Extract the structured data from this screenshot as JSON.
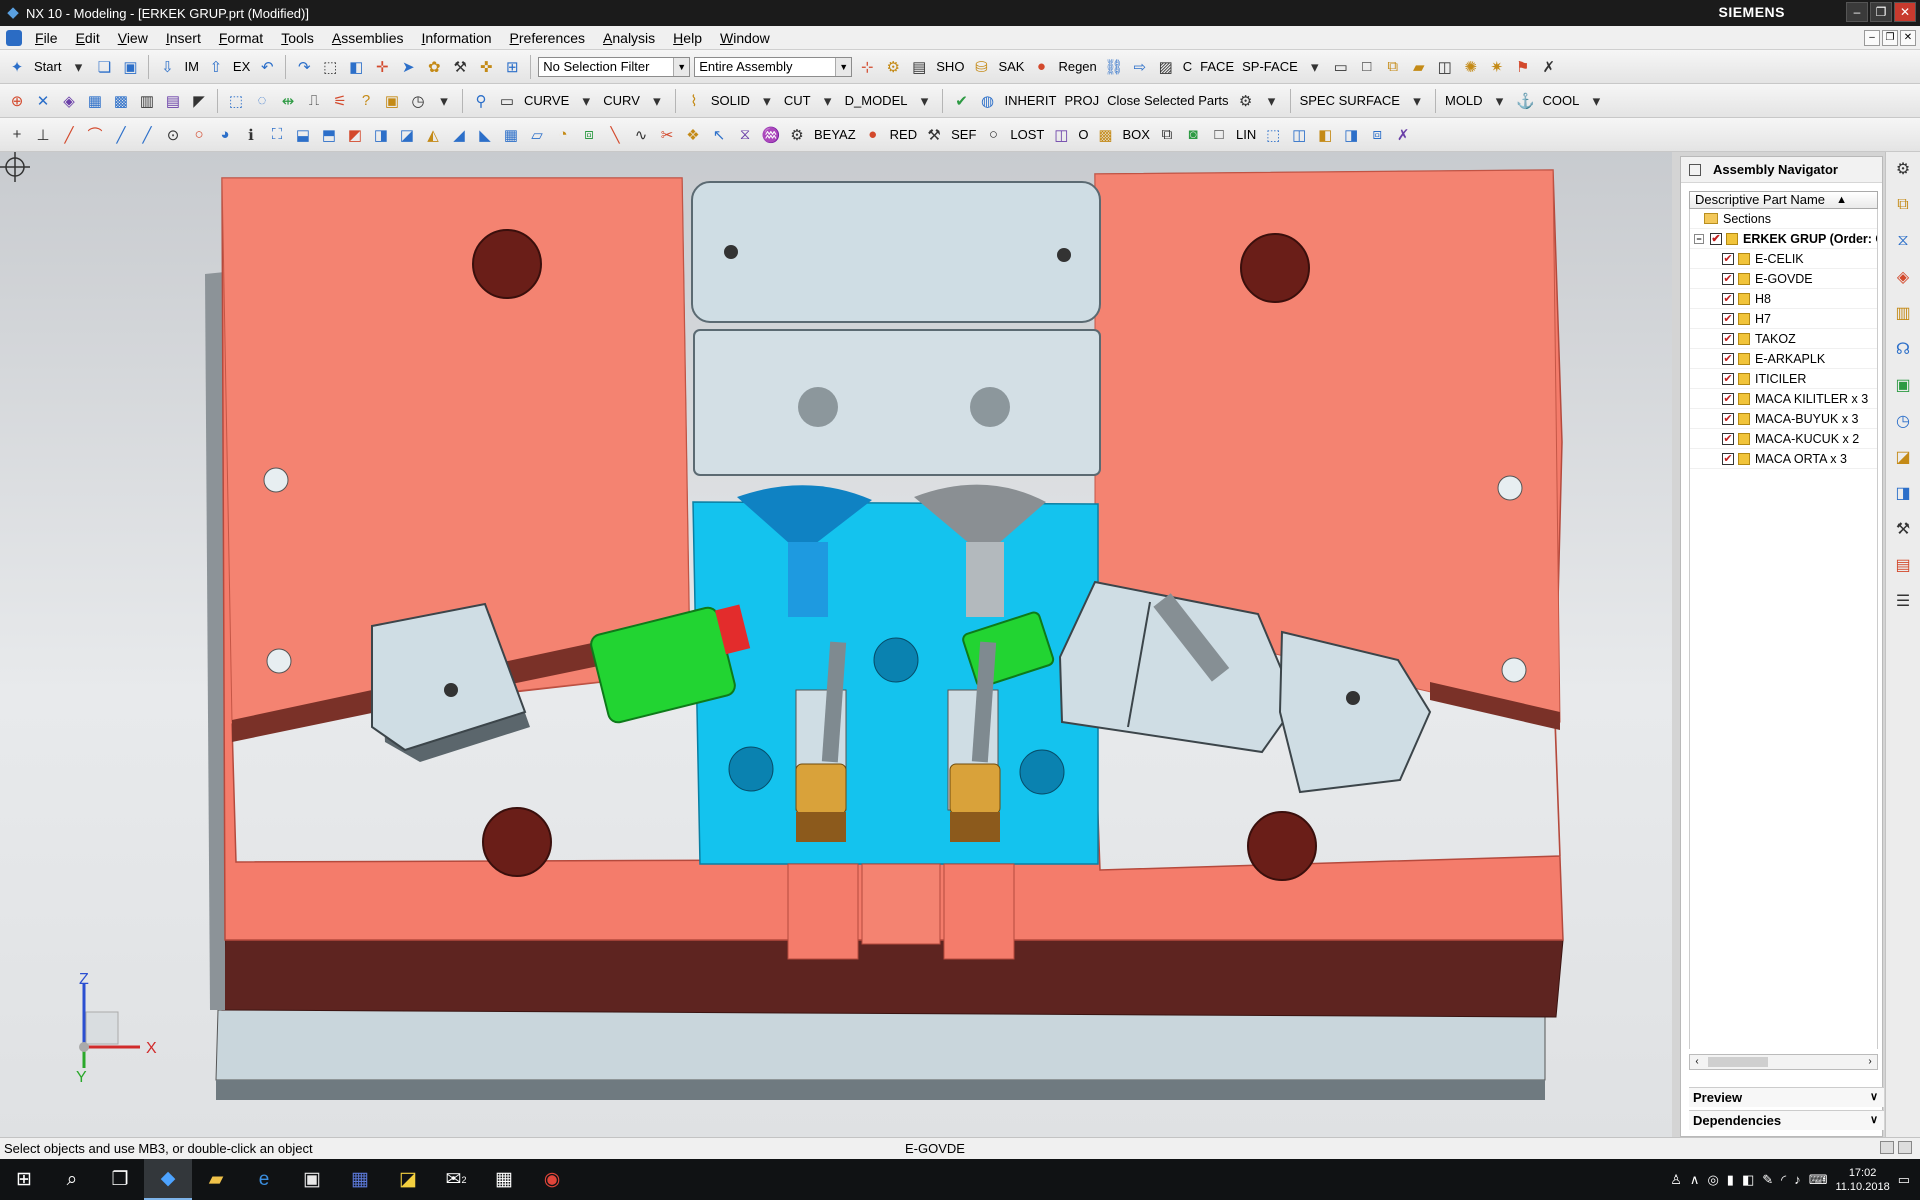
{
  "window": {
    "title": "NX 10 - Modeling - [ERKEK GRUP.prt (Modified)]",
    "brand": "SIEMENS"
  },
  "menu": [
    "File",
    "Edit",
    "View",
    "Insert",
    "Format",
    "Tools",
    "Assemblies",
    "Information",
    "Preferences",
    "Analysis",
    "Help",
    "Window"
  ],
  "toolbar1": {
    "start_label": "Start",
    "im_label": "IM",
    "ex_label": "EX",
    "selection_filter": "No Selection Filter",
    "scope": "Entire Assembly",
    "sho_label": "SHO",
    "sak_label": "SAK",
    "regen_label": "Regen",
    "c_label": "C",
    "face_label": "FACE",
    "spface_label": "SP-FACE"
  },
  "toolbar2": {
    "curve_label": "CURVE",
    "curv_label": "CURV",
    "solid_label": "SOLID",
    "cut_label": "CUT",
    "dmodel_label": "D_MODEL",
    "inherit_label": "INHERIT",
    "proj_label": "PROJ",
    "close_selected_label": "Close Selected Parts",
    "spec_surface_label": "SPEC SURFACE",
    "mold_label": "MOLD",
    "cool_label": "COOL"
  },
  "toolbar3": {
    "beyaz_label": "BEYAZ",
    "red_label": "RED",
    "sef_label": "SEF",
    "lost_label": "LOST",
    "o_label": "O",
    "box_label": "BOX",
    "lin_label": "LIN"
  },
  "navigator": {
    "title": "Assembly Navigator",
    "column_header": "Descriptive Part Name",
    "sections_label": "Sections",
    "root": "ERKEK GRUP (Order: C",
    "parts": [
      "E-CELIK",
      "E-GOVDE",
      "H8",
      "H7",
      "TAKOZ",
      "E-ARKAPLK",
      "ITICILER",
      "MACA KILITLER x 3",
      "MACA-BUYUK x 3",
      "MACA-KUCUK x 2",
      "MACA ORTA x 3"
    ],
    "preview_label": "Preview",
    "dependencies_label": "Dependencies"
  },
  "triad": {
    "z": "Z",
    "x": "X",
    "y": "Y"
  },
  "status": {
    "prompt": "Select objects and use MB3, or double-click an object",
    "selected": "E-GOVDE"
  },
  "clock": {
    "time": "17:02",
    "date": "11.10.2018"
  },
  "taskbar_badge": "2",
  "colors": {
    "plate": "#f47c6b",
    "plate_dark": "#5e2420",
    "cavity_blue": "#14c3ee",
    "insert_light": "#cfdde4",
    "green_part": "#22d432",
    "gold_part": "#d9a23a"
  }
}
